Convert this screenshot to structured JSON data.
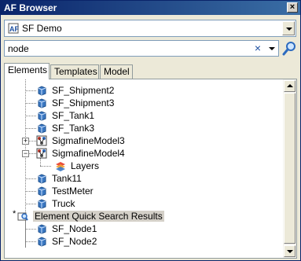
{
  "window": {
    "title": "AF Browser",
    "close_glyph": "×"
  },
  "server": {
    "name": "SF Demo",
    "icon": "af-database-icon"
  },
  "search": {
    "value": "node",
    "placeholder": "",
    "clear_glyph": "×"
  },
  "tabs": [
    {
      "label": "Elements",
      "active": true
    },
    {
      "label": "Templates",
      "active": false
    },
    {
      "label": "Model",
      "active": false
    }
  ],
  "tree": {
    "items": [
      {
        "label": "SF_Shipment2",
        "icon": "element-cube-icon"
      },
      {
        "label": "SF_Shipment3",
        "icon": "element-cube-icon"
      },
      {
        "label": "SF_Tank1",
        "icon": "element-cube-icon"
      },
      {
        "label": "SF_Tank3",
        "icon": "element-cube-icon"
      },
      {
        "label": "SigmafineModel3",
        "icon": "model-icon",
        "expander": "+"
      },
      {
        "label": "SigmafineModel4",
        "icon": "model-icon",
        "expander": "−"
      },
      {
        "label": "Layers",
        "icon": "layers-icon"
      },
      {
        "label": "Tank11",
        "icon": "element-cube-icon"
      },
      {
        "label": "TestMeter",
        "icon": "element-cube-icon"
      },
      {
        "label": "Truck",
        "icon": "element-cube-icon"
      },
      {
        "label": "Element Quick Search Results",
        "icon": "search-results-icon",
        "badge": "*"
      },
      {
        "label": "SF_Node1",
        "icon": "element-cube-icon"
      },
      {
        "label": "SF_Node2",
        "icon": "element-cube-icon"
      }
    ]
  },
  "colors": {
    "cube": "#3b78c2",
    "title_start": "#0a246a",
    "title_end": "#3a6ea5",
    "selected_bg": "#d4d0c8"
  }
}
